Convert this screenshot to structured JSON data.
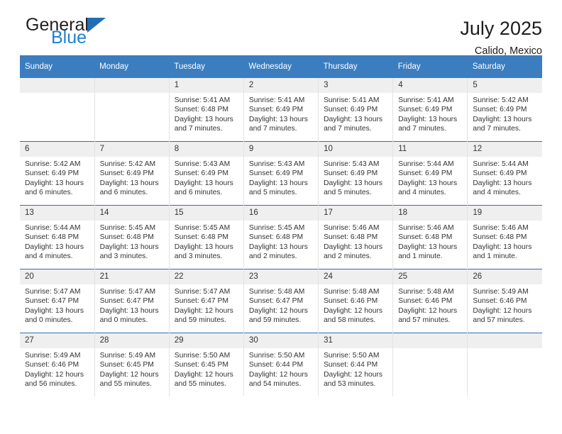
{
  "brand": {
    "name_part1": "General",
    "name_part2": "Blue",
    "logo_icon": "blue-triangle-icon"
  },
  "header": {
    "title": "July 2025",
    "subtitle": "Calido, Mexico"
  },
  "colors": {
    "header_blue": "#3b7dbf",
    "rule_blue": "#2f6fb0",
    "daynum_band": "#efefef",
    "brand_blue": "#1f7fd4",
    "text": "#333333"
  },
  "weekday_headers": [
    "Sunday",
    "Monday",
    "Tuesday",
    "Wednesday",
    "Thursday",
    "Friday",
    "Saturday"
  ],
  "weeks": [
    [
      {
        "day": "",
        "empty": true,
        "sunrise": "",
        "sunset": "",
        "daylight_line1": "",
        "daylight_line2": ""
      },
      {
        "day": "",
        "empty": true,
        "sunrise": "",
        "sunset": "",
        "daylight_line1": "",
        "daylight_line2": ""
      },
      {
        "day": "1",
        "sunrise": "Sunrise: 5:41 AM",
        "sunset": "Sunset: 6:48 PM",
        "daylight_line1": "Daylight: 13 hours",
        "daylight_line2": "and 7 minutes."
      },
      {
        "day": "2",
        "sunrise": "Sunrise: 5:41 AM",
        "sunset": "Sunset: 6:49 PM",
        "daylight_line1": "Daylight: 13 hours",
        "daylight_line2": "and 7 minutes."
      },
      {
        "day": "3",
        "sunrise": "Sunrise: 5:41 AM",
        "sunset": "Sunset: 6:49 PM",
        "daylight_line1": "Daylight: 13 hours",
        "daylight_line2": "and 7 minutes."
      },
      {
        "day": "4",
        "sunrise": "Sunrise: 5:41 AM",
        "sunset": "Sunset: 6:49 PM",
        "daylight_line1": "Daylight: 13 hours",
        "daylight_line2": "and 7 minutes."
      },
      {
        "day": "5",
        "sunrise": "Sunrise: 5:42 AM",
        "sunset": "Sunset: 6:49 PM",
        "daylight_line1": "Daylight: 13 hours",
        "daylight_line2": "and 7 minutes."
      }
    ],
    [
      {
        "day": "6",
        "sunrise": "Sunrise: 5:42 AM",
        "sunset": "Sunset: 6:49 PM",
        "daylight_line1": "Daylight: 13 hours",
        "daylight_line2": "and 6 minutes."
      },
      {
        "day": "7",
        "sunrise": "Sunrise: 5:42 AM",
        "sunset": "Sunset: 6:49 PM",
        "daylight_line1": "Daylight: 13 hours",
        "daylight_line2": "and 6 minutes."
      },
      {
        "day": "8",
        "sunrise": "Sunrise: 5:43 AM",
        "sunset": "Sunset: 6:49 PM",
        "daylight_line1": "Daylight: 13 hours",
        "daylight_line2": "and 6 minutes."
      },
      {
        "day": "9",
        "sunrise": "Sunrise: 5:43 AM",
        "sunset": "Sunset: 6:49 PM",
        "daylight_line1": "Daylight: 13 hours",
        "daylight_line2": "and 5 minutes."
      },
      {
        "day": "10",
        "sunrise": "Sunrise: 5:43 AM",
        "sunset": "Sunset: 6:49 PM",
        "daylight_line1": "Daylight: 13 hours",
        "daylight_line2": "and 5 minutes."
      },
      {
        "day": "11",
        "sunrise": "Sunrise: 5:44 AM",
        "sunset": "Sunset: 6:49 PM",
        "daylight_line1": "Daylight: 13 hours",
        "daylight_line2": "and 4 minutes."
      },
      {
        "day": "12",
        "sunrise": "Sunrise: 5:44 AM",
        "sunset": "Sunset: 6:49 PM",
        "daylight_line1": "Daylight: 13 hours",
        "daylight_line2": "and 4 minutes."
      }
    ],
    [
      {
        "day": "13",
        "sunrise": "Sunrise: 5:44 AM",
        "sunset": "Sunset: 6:48 PM",
        "daylight_line1": "Daylight: 13 hours",
        "daylight_line2": "and 4 minutes."
      },
      {
        "day": "14",
        "sunrise": "Sunrise: 5:45 AM",
        "sunset": "Sunset: 6:48 PM",
        "daylight_line1": "Daylight: 13 hours",
        "daylight_line2": "and 3 minutes."
      },
      {
        "day": "15",
        "sunrise": "Sunrise: 5:45 AM",
        "sunset": "Sunset: 6:48 PM",
        "daylight_line1": "Daylight: 13 hours",
        "daylight_line2": "and 3 minutes."
      },
      {
        "day": "16",
        "sunrise": "Sunrise: 5:45 AM",
        "sunset": "Sunset: 6:48 PM",
        "daylight_line1": "Daylight: 13 hours",
        "daylight_line2": "and 2 minutes."
      },
      {
        "day": "17",
        "sunrise": "Sunrise: 5:46 AM",
        "sunset": "Sunset: 6:48 PM",
        "daylight_line1": "Daylight: 13 hours",
        "daylight_line2": "and 2 minutes."
      },
      {
        "day": "18",
        "sunrise": "Sunrise: 5:46 AM",
        "sunset": "Sunset: 6:48 PM",
        "daylight_line1": "Daylight: 13 hours",
        "daylight_line2": "and 1 minute."
      },
      {
        "day": "19",
        "sunrise": "Sunrise: 5:46 AM",
        "sunset": "Sunset: 6:48 PM",
        "daylight_line1": "Daylight: 13 hours",
        "daylight_line2": "and 1 minute."
      }
    ],
    [
      {
        "day": "20",
        "sunrise": "Sunrise: 5:47 AM",
        "sunset": "Sunset: 6:47 PM",
        "daylight_line1": "Daylight: 13 hours",
        "daylight_line2": "and 0 minutes."
      },
      {
        "day": "21",
        "sunrise": "Sunrise: 5:47 AM",
        "sunset": "Sunset: 6:47 PM",
        "daylight_line1": "Daylight: 13 hours",
        "daylight_line2": "and 0 minutes."
      },
      {
        "day": "22",
        "sunrise": "Sunrise: 5:47 AM",
        "sunset": "Sunset: 6:47 PM",
        "daylight_line1": "Daylight: 12 hours",
        "daylight_line2": "and 59 minutes."
      },
      {
        "day": "23",
        "sunrise": "Sunrise: 5:48 AM",
        "sunset": "Sunset: 6:47 PM",
        "daylight_line1": "Daylight: 12 hours",
        "daylight_line2": "and 59 minutes."
      },
      {
        "day": "24",
        "sunrise": "Sunrise: 5:48 AM",
        "sunset": "Sunset: 6:46 PM",
        "daylight_line1": "Daylight: 12 hours",
        "daylight_line2": "and 58 minutes."
      },
      {
        "day": "25",
        "sunrise": "Sunrise: 5:48 AM",
        "sunset": "Sunset: 6:46 PM",
        "daylight_line1": "Daylight: 12 hours",
        "daylight_line2": "and 57 minutes."
      },
      {
        "day": "26",
        "sunrise": "Sunrise: 5:49 AM",
        "sunset": "Sunset: 6:46 PM",
        "daylight_line1": "Daylight: 12 hours",
        "daylight_line2": "and 57 minutes."
      }
    ],
    [
      {
        "day": "27",
        "sunrise": "Sunrise: 5:49 AM",
        "sunset": "Sunset: 6:46 PM",
        "daylight_line1": "Daylight: 12 hours",
        "daylight_line2": "and 56 minutes."
      },
      {
        "day": "28",
        "sunrise": "Sunrise: 5:49 AM",
        "sunset": "Sunset: 6:45 PM",
        "daylight_line1": "Daylight: 12 hours",
        "daylight_line2": "and 55 minutes."
      },
      {
        "day": "29",
        "sunrise": "Sunrise: 5:50 AM",
        "sunset": "Sunset: 6:45 PM",
        "daylight_line1": "Daylight: 12 hours",
        "daylight_line2": "and 55 minutes."
      },
      {
        "day": "30",
        "sunrise": "Sunrise: 5:50 AM",
        "sunset": "Sunset: 6:44 PM",
        "daylight_line1": "Daylight: 12 hours",
        "daylight_line2": "and 54 minutes."
      },
      {
        "day": "31",
        "sunrise": "Sunrise: 5:50 AM",
        "sunset": "Sunset: 6:44 PM",
        "daylight_line1": "Daylight: 12 hours",
        "daylight_line2": "and 53 minutes."
      },
      {
        "day": "",
        "empty": true,
        "sunrise": "",
        "sunset": "",
        "daylight_line1": "",
        "daylight_line2": ""
      },
      {
        "day": "",
        "empty": true,
        "sunrise": "",
        "sunset": "",
        "daylight_line1": "",
        "daylight_line2": ""
      }
    ]
  ]
}
